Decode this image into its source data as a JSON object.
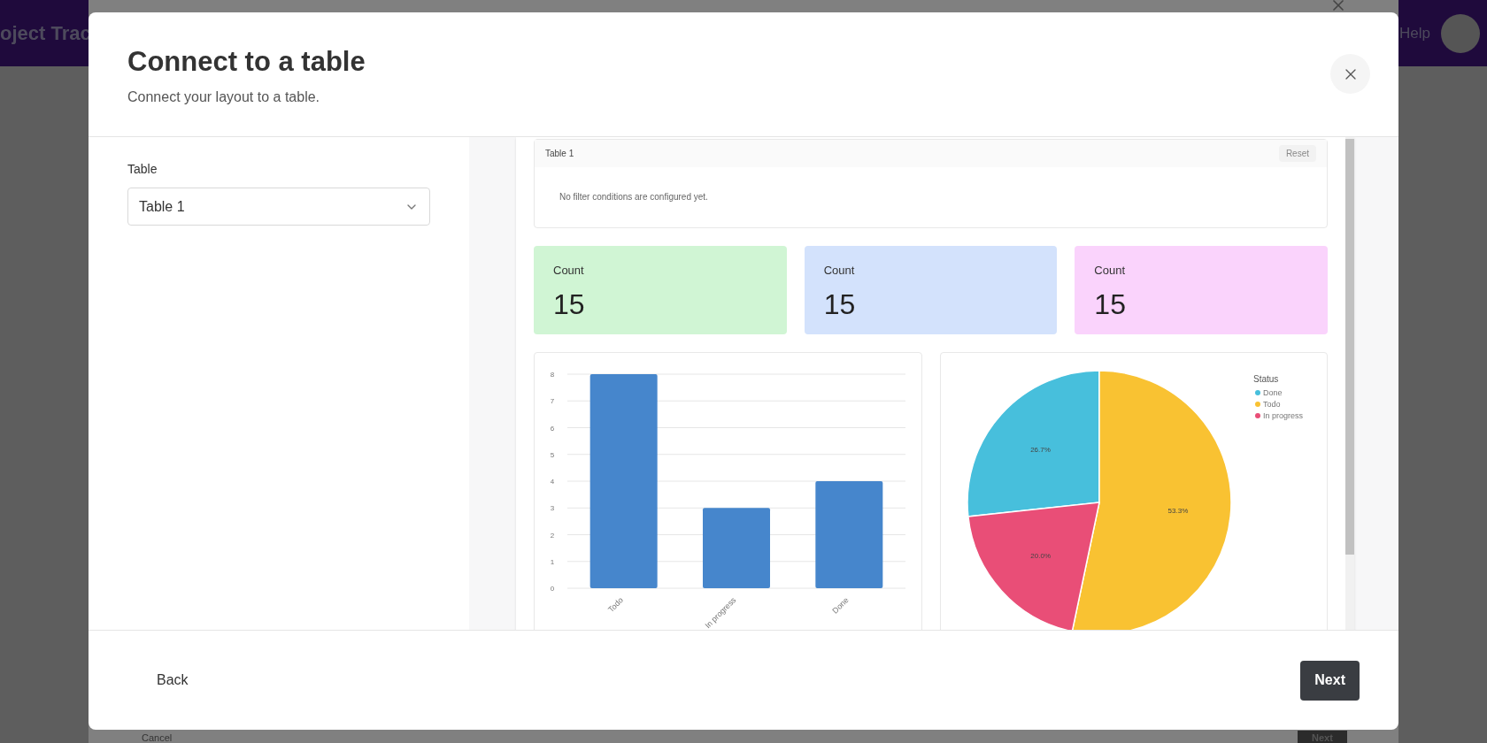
{
  "background_app": {
    "title": "oject Trac",
    "help_link": "Help"
  },
  "background_dialog": {
    "buttons": [
      "Cancel",
      "Next"
    ]
  },
  "dialog": {
    "title": "Connect to a table",
    "subtitle": "Connect your layout to a table.",
    "table_field": {
      "label": "Table",
      "value": "Table 1"
    },
    "preview": {
      "filter": {
        "title": "Table 1",
        "reset": "Reset",
        "message": "No filter conditions are configured yet."
      },
      "stat_cards": [
        {
          "label": "Count",
          "value": "15",
          "color": "#d0f5d4"
        },
        {
          "label": "Count",
          "value": "15",
          "color": "#d3e2fc"
        },
        {
          "label": "Count",
          "value": "15",
          "color": "#fad3fc"
        }
      ],
      "bar_chart": {
        "chart_data": {
          "type": "bar",
          "categories": [
            "Todo",
            "In progress",
            "Done"
          ],
          "values": [
            8,
            3,
            4
          ],
          "ylim": [
            0,
            8
          ],
          "yticks": [
            0,
            1,
            2,
            3,
            4,
            5,
            6,
            7,
            8
          ],
          "grid": true
        }
      },
      "pie_chart": {
        "legend_title": "Status",
        "chart_data": {
          "type": "pie",
          "categories": [
            "Done",
            "Todo",
            "In progress"
          ],
          "values": [
            26.7,
            53.3,
            20.0
          ],
          "colors": [
            "#47bfdc",
            "#f9c232",
            "#e94e77"
          ],
          "value_labels": [
            "26.7%",
            "53.3%",
            "20.0%"
          ],
          "legend": "right"
        }
      }
    },
    "footer": {
      "back": "Back",
      "next": "Next"
    }
  }
}
